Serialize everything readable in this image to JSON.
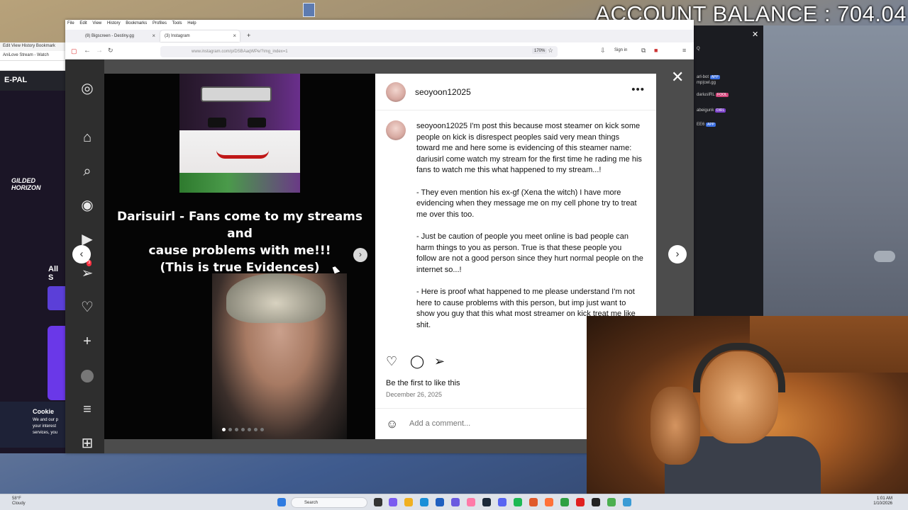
{
  "overlay": {
    "balance": "ACCOUNT BALANCE : 704.04"
  },
  "back_browser": {
    "menu": "Edit  View  History  Bookmark",
    "tab": "AniLove Stream - Watch",
    "brand": "E-PAL",
    "game_title": "GILDED HORIZON",
    "section": "All S",
    "cookie_title": "Cookie",
    "cookie_text": "We and our p\nyour interest\nservices, you"
  },
  "chat": {
    "rows": [
      {
        "name": "arl-bot",
        "badge": "APP"
      },
      {
        "name": "mp|cwl.gg",
        "badge": ""
      },
      {
        "name": "dariusIRL",
        "badge": "FOOL"
      },
      {
        "name": "abeigunk",
        "badge": "DIRL"
      },
      {
        "name": "EE6",
        "badge": "APP"
      }
    ],
    "search_hint": "Q"
  },
  "firefox": {
    "menu": [
      "File",
      "Edit",
      "View",
      "History",
      "Bookmarks",
      "Profiles",
      "Tools",
      "Help"
    ],
    "tabs": [
      {
        "label": "(8) Bigscreen - Destiny.gg"
      },
      {
        "label": "(3) Instagram"
      }
    ],
    "new_tab": "+",
    "url": "www.instagram.com/p/DSBAaqWPe/?img_index=1",
    "zoom": "170%",
    "sign_in": "Sign in"
  },
  "instagram": {
    "sidebar_icons": [
      "instagram-logo-icon",
      "home-icon",
      "search-icon",
      "explore-icon",
      "reels-icon",
      "messages-icon",
      "notifications-icon",
      "create-icon",
      "profile-icon",
      "menu-icon",
      "apps-icon"
    ],
    "notification_count": "3",
    "media": {
      "title_line1": "Darisuirl - Fans come to my streams and",
      "title_line2": "cause problems with me!!!",
      "title_line3": "(This is true Evidences)",
      "dots": 7,
      "active_dot": 0
    },
    "post": {
      "username": "seoyoon12025",
      "more": "•••",
      "caption_user": "seoyoon12025",
      "caption": " I'm post this because most steamer on kick some people on kick is disrespect peoples said very mean things toward me and here some is evidencing of this steamer name: dariusirl come watch my stream for the first time he rading me his fans to watch me this what happened to my stream...!\n\n- They even mention his ex-gf (Xena the witch) I have more evidencing when they message me on my cell phone try to treat me over this too.\n\n- Just be caution of people you meet online is bad people can harm things to you as person. True is that these people you follow are not a good person since they hurt normal people on the internet so...!\n\n- Here is proof what happened to me please understand I'm not here to cause problems with this person, but imp just want to show you guy that this what most streamer on kick treat me like shit.",
      "likes": "Be the first to like this",
      "date": "December 26, 2025",
      "comment_placeholder": "Add a comment..."
    }
  },
  "taskbar": {
    "weather_temp": "58°F",
    "weather_desc": "Cloudy",
    "search": "Search",
    "time": "1:01 AM",
    "date": "1/10/2026"
  },
  "colors": {
    "instagram_bg": "#4c4c4c",
    "badge_blue": "#3b6fe0"
  }
}
